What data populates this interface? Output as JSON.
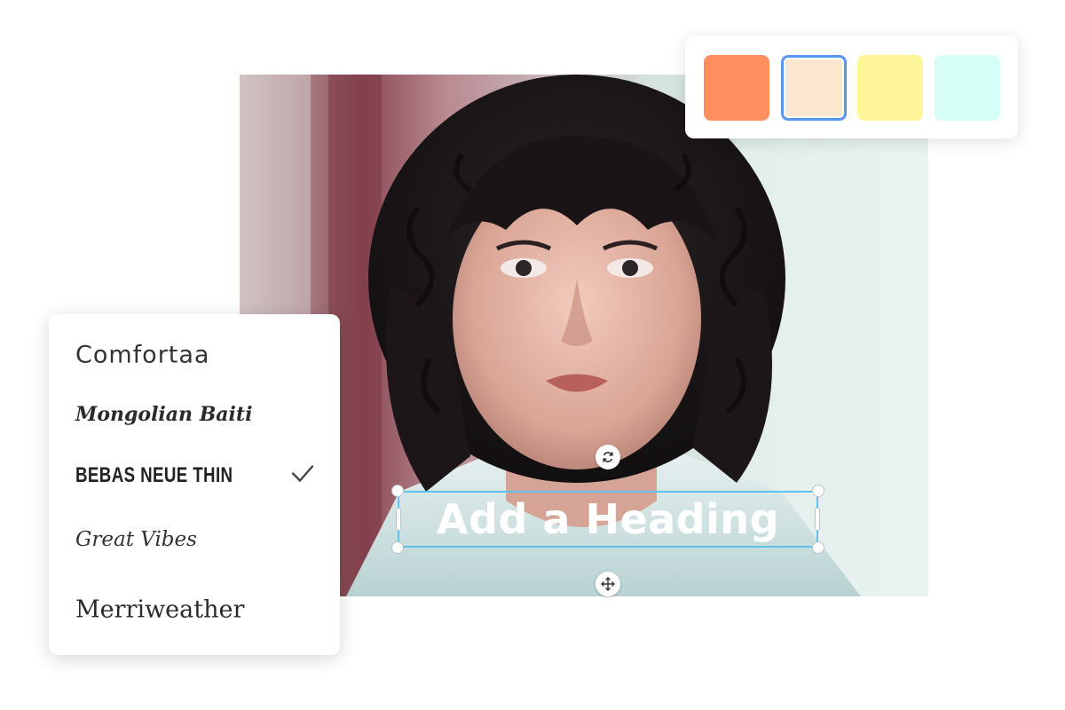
{
  "canvas": {
    "heading_text": "Add a Heading"
  },
  "palette": {
    "swatches": [
      {
        "color": "#ff8f5f",
        "selected": false
      },
      {
        "color": "#fbe7cf",
        "selected": true
      },
      {
        "color": "#fff69a",
        "selected": false
      },
      {
        "color": "#d6fdf6",
        "selected": false
      }
    ],
    "selected_border_color": "#5a95f0"
  },
  "fonts": {
    "items": [
      {
        "label": "Comfortaa",
        "selected": false
      },
      {
        "label": "Mongolian Baiti",
        "selected": false
      },
      {
        "label": "BEBAS NEUE THIN",
        "selected": true
      },
      {
        "label": "Great Vibes",
        "selected": false
      },
      {
        "label": "Merriweather",
        "selected": false
      }
    ],
    "check_icon": "checkmark-icon"
  },
  "colors": {
    "selection_outline": "#5ec2ec",
    "heading_color": "#ffffff"
  }
}
